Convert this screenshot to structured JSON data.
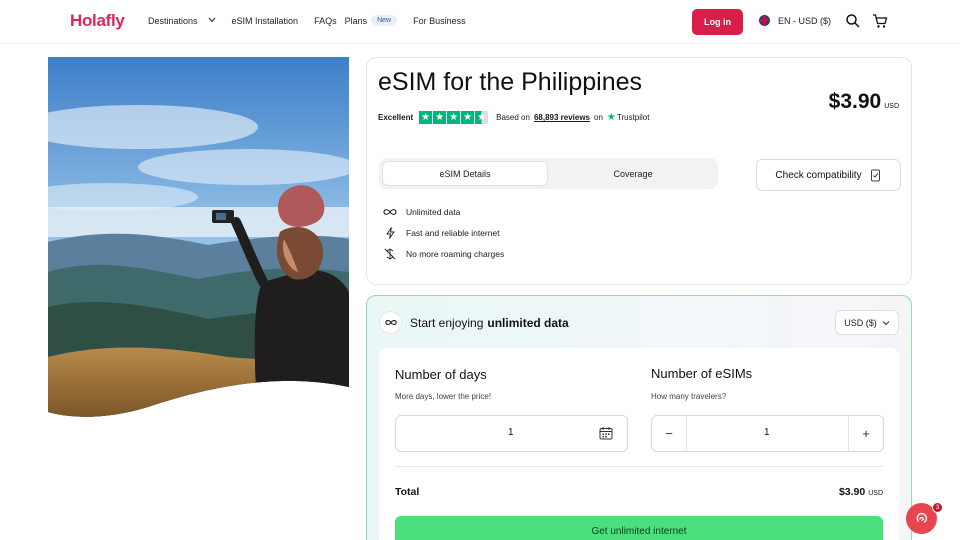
{
  "header": {
    "logo": "Holafly",
    "nav": [
      {
        "label": "Destinations"
      },
      {
        "label": "eSIM Installation"
      },
      {
        "label": "FAQs"
      },
      {
        "label": "Plans",
        "badge": "New"
      },
      {
        "label": "For Business"
      }
    ],
    "login": "Log in",
    "language": "EN - USD ($)"
  },
  "product": {
    "title": "eSIM for the Philippines",
    "price": "$3.90",
    "price_currency": "USD",
    "rating_label": "Excellent",
    "stars": 4.5,
    "reviews_prefix": "Based on",
    "reviews_count": "68,893 reviews",
    "reviews_suffix": "on",
    "trustpilot": "Trustpilot",
    "tabs": [
      "eSIM Details",
      "Coverage"
    ],
    "compat_button": "Check compatibility",
    "features": [
      "Unlimited data",
      "Fast and reliable internet",
      "No more roaming charges"
    ]
  },
  "plan": {
    "heading_prefix": "Start enjoying",
    "heading_bold": "unlimited data",
    "currency_select": "USD ($)",
    "days": {
      "title": "Number of days",
      "subtitle": "More days, lower the price!",
      "value": "1"
    },
    "esims": {
      "title": "Number of eSIMs",
      "subtitle": "How many travelers?",
      "value": "1"
    },
    "total_label": "Total",
    "total_value": "$3.90",
    "total_currency": "USD",
    "cta": "Get unlimited internet"
  },
  "chat": {
    "badge": "3"
  },
  "colors": {
    "brand": "#e0245e",
    "login": "#d91e4a",
    "cta": "#4ae07e",
    "trustpilot": "#00b67a"
  }
}
